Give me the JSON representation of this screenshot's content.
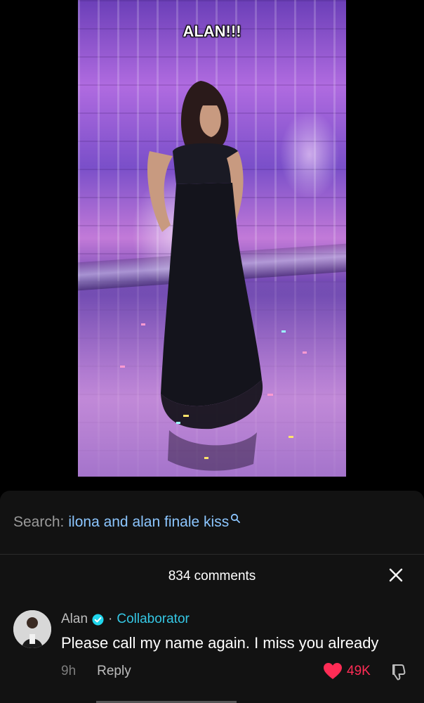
{
  "video": {
    "caption": "ALAN!!!"
  },
  "search": {
    "label": "Search:",
    "query": "ilona and alan finale kiss"
  },
  "comments": {
    "count_label": "834 comments",
    "items": [
      {
        "author": "Alan",
        "separator": "·",
        "badge": "Collaborator",
        "text": "Please call my name again. I miss you already",
        "time": "9h",
        "reply_label": "Reply",
        "likes": "49K"
      }
    ]
  },
  "colors": {
    "accent_link": "#8cc6ff",
    "collaborator": "#35c7e4",
    "like": "#fe2c55",
    "verified": "#20d5ec",
    "sheet_bg": "#121212"
  }
}
